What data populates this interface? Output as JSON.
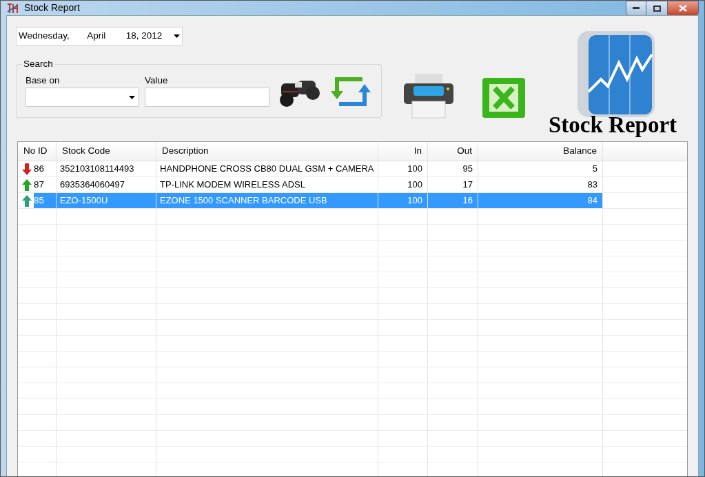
{
  "window": {
    "title": "Stock Report"
  },
  "date_picker": {
    "day": "Wednesday,",
    "month": "April",
    "date": "18, 2012"
  },
  "search": {
    "title": "Search",
    "base_on": {
      "label": "Base on"
    },
    "value": {
      "label": "Value"
    }
  },
  "logo": {
    "text": "Stock Report"
  },
  "table": {
    "columns": [
      "No ID",
      "Stock Code",
      "Description",
      "In",
      "Out",
      "Balance"
    ],
    "rows": [
      {
        "kind": "down",
        "id": "86",
        "code": "352103108114493",
        "description": "HANDPHONE CROSS CB80 DUAL GSM + CAMERA",
        "in": "100",
        "out": "95",
        "balance": "5",
        "selected": false
      },
      {
        "kind": "up",
        "id": "87",
        "code": "6935364060497",
        "description": "TP-LINK MODEM WIRELESS ADSL",
        "in": "100",
        "out": "17",
        "balance": "83",
        "selected": false
      },
      {
        "kind": "up",
        "id": "85",
        "code": "EZO-1500U",
        "description": "EZONE 1500 SCANNER BARCODE USB",
        "in": "100",
        "out": "16",
        "balance": "84",
        "selected": true
      }
    ]
  }
}
